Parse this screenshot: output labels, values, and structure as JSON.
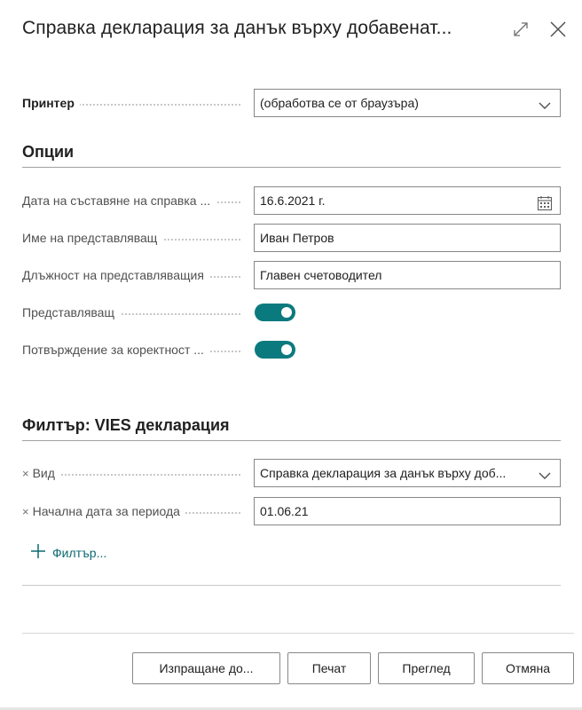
{
  "dialog": {
    "title": "Справка декларация за данък върху добавенат...",
    "icons": {
      "expand": "expand-icon",
      "close": "close-icon"
    }
  },
  "printer": {
    "label": "Принтер",
    "value": "(обработва се от браузъра)"
  },
  "options": {
    "header": "Опции",
    "fields": {
      "date": {
        "label": "Дата на съставяне на справка ...",
        "value": "16.6.2021 г."
      },
      "rep_name": {
        "label": "Име на представляващ",
        "value": "Иван Петров"
      },
      "rep_position": {
        "label": "Длъжност на представляващия",
        "value": "Главен счетоводител"
      },
      "representative": {
        "label": "Представляващ",
        "on": true
      },
      "confirm": {
        "label": "Потвърждение за коректност ...",
        "on": true
      }
    }
  },
  "filter": {
    "header": "Филтър: VIES декларация",
    "type": {
      "remove": "×",
      "label": "Вид",
      "value": "Справка декларация за данък върху доб..."
    },
    "start": {
      "remove": "×",
      "label": "Начална дата за периода",
      "value": "01.06.21"
    },
    "add_label": "Филтър..."
  },
  "buttons": {
    "send": "Изпращане до...",
    "print": "Печат",
    "preview": "Преглед",
    "cancel": "Отмяна"
  },
  "colors": {
    "accent": "#0b7a7f",
    "link": "#0b6a72"
  }
}
